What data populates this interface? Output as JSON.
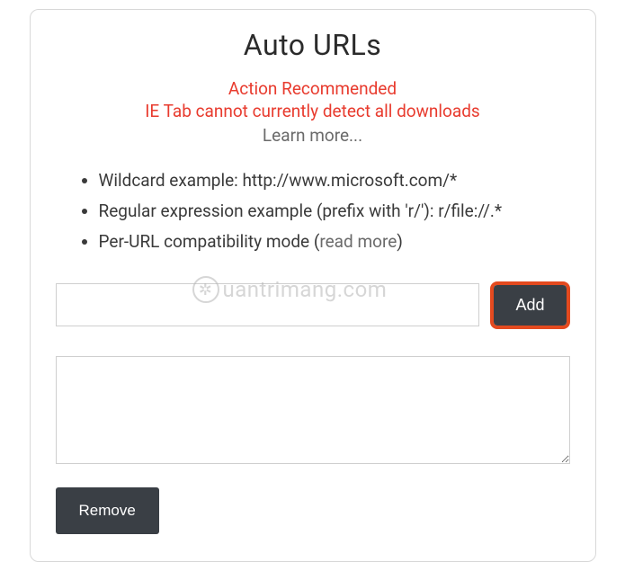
{
  "title": "Auto URLs",
  "warning": {
    "line1": "Action Recommended",
    "line2": "IE Tab cannot currently detect all downloads",
    "learn_more": "Learn more..."
  },
  "bullets": {
    "item0": "Wildcard example: http://www.microsoft.com/*",
    "item1": "Regular expression example (prefix with 'r/'): r/file://.*",
    "item2_prefix": "Per-URL compatibility mode (",
    "item2_link": "read more",
    "item2_suffix": ")"
  },
  "input": {
    "url_value": "",
    "add_label": "Add",
    "textarea_value": "",
    "remove_label": "Remove"
  },
  "watermark": {
    "text": "uantrimang.com"
  }
}
